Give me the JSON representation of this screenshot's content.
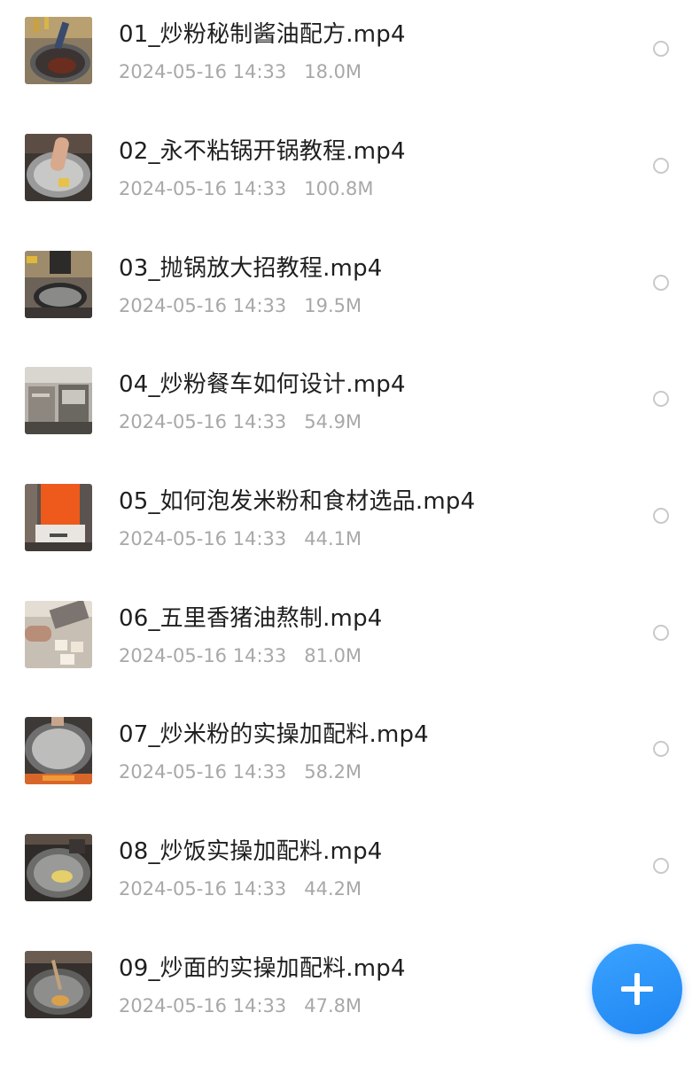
{
  "files": [
    {
      "name": "01_炒粉秘制酱油配方.mp4",
      "date": "2024-05-16 14:33",
      "size": "18.0M",
      "thumb": "wok-sauce-thumbnail"
    },
    {
      "name": "02_永不粘锅开锅教程.mp4",
      "date": "2024-05-16 14:33",
      "size": "100.8M",
      "thumb": "wok-seasoning-thumbnail"
    },
    {
      "name": "03_抛锅放大招教程.mp4",
      "date": "2024-05-16 14:33",
      "size": "19.5M",
      "thumb": "wok-tossing-thumbnail"
    },
    {
      "name": "04_炒粉餐车如何设计.mp4",
      "date": "2024-05-16 14:33",
      "size": "54.9M",
      "thumb": "food-cart-thumbnail"
    },
    {
      "name": "05_如何泡发米粉和食材选品.mp4",
      "date": "2024-05-16 14:33",
      "size": "44.1M",
      "thumb": "cook-orange-shirt-thumbnail"
    },
    {
      "name": "06_五里香猪油熬制.mp4",
      "date": "2024-05-16 14:33",
      "size": "81.0M",
      "thumb": "lard-cutting-thumbnail"
    },
    {
      "name": "07_炒米粉的实操加配料.mp4",
      "date": "2024-05-16 14:33",
      "size": "58.2M",
      "thumb": "wok-fire-thumbnail"
    },
    {
      "name": "08_炒饭实操加配料.mp4",
      "date": "2024-05-16 14:33",
      "size": "44.2M",
      "thumb": "fried-rice-wok-thumbnail"
    },
    {
      "name": "09_炒面的实操加配料.mp4",
      "date": "2024-05-16 14:33",
      "size": "47.8M",
      "thumb": "noodle-wok-thumbnail"
    }
  ],
  "fab": {
    "icon": "plus-icon"
  },
  "colors": {
    "accent": "#2b95fb",
    "title_text": "#1f1f1f",
    "meta_text": "#a8a8a8",
    "radio_border": "#c9c9c9"
  }
}
